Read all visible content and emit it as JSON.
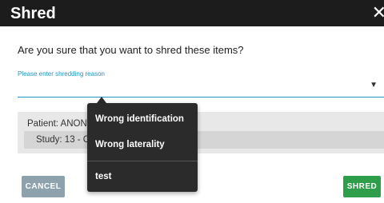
{
  "dialog": {
    "title": "Shred",
    "close_glyph": "✕",
    "question": "Are you sure that you want to shred these items?"
  },
  "reason_select": {
    "label": "Please enter shredding reason",
    "arrow_glyph": "▼",
    "options": [
      "Wrong identification",
      "Wrong laterality",
      "test"
    ]
  },
  "items": {
    "patient_label": "Patient: ANONY",
    "study_label": "Study: 13 - C"
  },
  "buttons": {
    "cancel": "CANCEL",
    "shred": "SHRED"
  },
  "colors": {
    "titlebar": "#1c1c1c",
    "accent": "#2196c4",
    "cancel": "#8ea2ae",
    "shred": "#2e9e4a",
    "menu": "#2b2b2b"
  }
}
